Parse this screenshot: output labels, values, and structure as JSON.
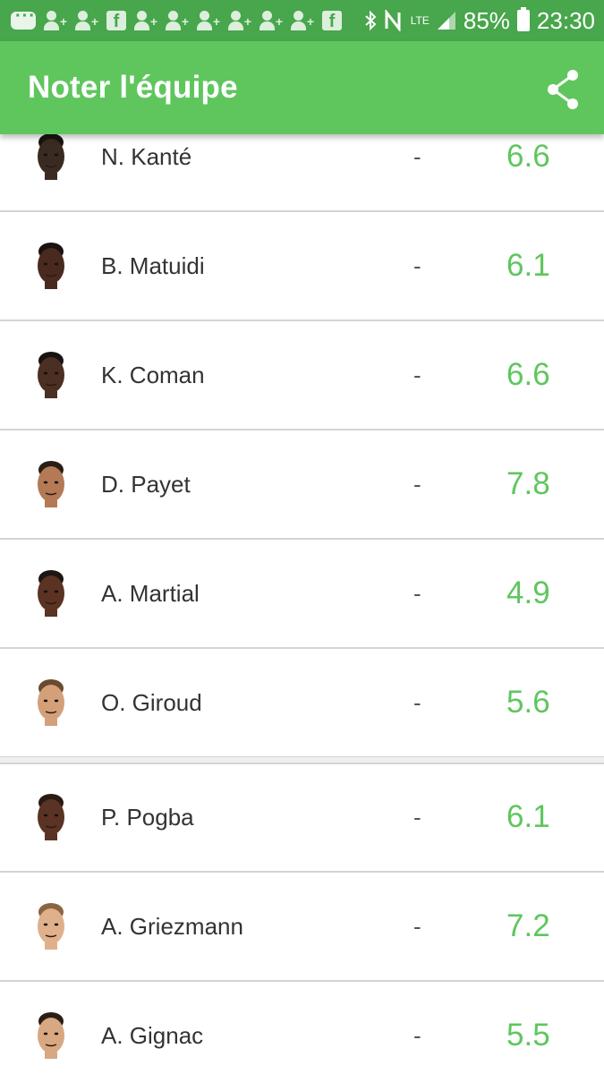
{
  "status_bar": {
    "battery": "85%",
    "time": "23:30",
    "network": "LTE",
    "icons": [
      "chat-icon",
      "add-contact-icon",
      "add-contact-icon",
      "facebook-icon",
      "add-contact-icon",
      "add-contact-icon",
      "add-contact-icon",
      "add-contact-icon",
      "add-contact-icon",
      "add-contact-icon",
      "facebook-icon",
      "bluetooth-icon",
      "nfc-icon",
      "lte-icon",
      "signal-icon",
      "battery-icon"
    ]
  },
  "app_bar": {
    "title": "Noter l'équipe",
    "action_icon": "share-icon"
  },
  "colors": {
    "status_bar": "#48a64c",
    "app_bar": "#5fc65e",
    "rating": "#5fc65e"
  },
  "players": [
    {
      "name": "N. Kanté",
      "note": "-",
      "rating": "6.6",
      "skin": "#3a2a22",
      "hair": "#1a1411"
    },
    {
      "name": "B. Matuidi",
      "note": "-",
      "rating": "6.1",
      "skin": "#4a2a1e",
      "hair": "#1a120e"
    },
    {
      "name": "K. Coman",
      "note": "-",
      "rating": "6.6",
      "skin": "#4b2f22",
      "hair": "#171311"
    },
    {
      "name": "D. Payet",
      "note": "-",
      "rating": "7.8",
      "skin": "#b37a55",
      "hair": "#2a1d16"
    },
    {
      "name": "A. Martial",
      "note": "-",
      "rating": "4.9",
      "skin": "#5a3322",
      "hair": "#1c1512"
    },
    {
      "name": "O. Giroud",
      "note": "-",
      "rating": "5.6",
      "skin": "#d4a07a",
      "hair": "#6b4a2e"
    }
  ],
  "substitutes": [
    {
      "name": "P. Pogba",
      "note": "-",
      "rating": "6.1",
      "skin": "#5a3324",
      "hair": "#2a1a12"
    },
    {
      "name": "A. Griezmann",
      "note": "-",
      "rating": "7.2",
      "skin": "#e0b08c",
      "hair": "#8a6540"
    },
    {
      "name": "A. Gignac",
      "note": "-",
      "rating": "5.5",
      "skin": "#d8a882",
      "hair": "#2b1e16"
    }
  ]
}
